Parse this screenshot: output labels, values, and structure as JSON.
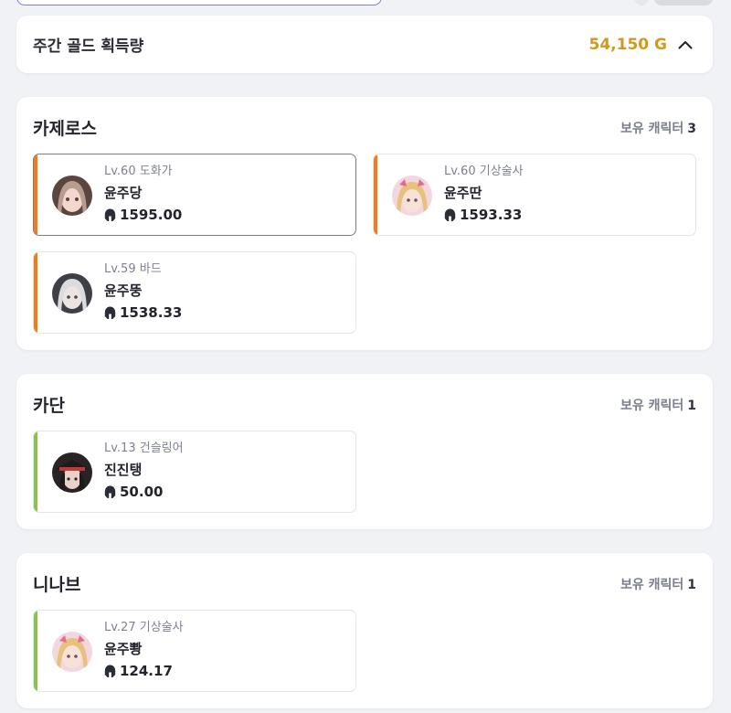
{
  "colors": {
    "gold": "#d4981c",
    "bar_orange": "#f07d1a",
    "bar_green": "#8bc34a",
    "bg": "#f1f2f6"
  },
  "weekly": {
    "title": "주간 골드 획득량",
    "gold": "54,150 G",
    "toggle_icon": "chevron-up-icon"
  },
  "count_label": "보유 캐릭터",
  "servers": [
    {
      "name": "카제로스",
      "count": "3",
      "characters": [
        {
          "level": "Lv.60",
          "class": "도화가",
          "name": "윤주당",
          "item_level": "1595.00",
          "bar": "orange",
          "avatar": "a1",
          "selected": true
        },
        {
          "level": "Lv.60",
          "class": "기상술사",
          "name": "윤주딴",
          "item_level": "1593.33",
          "bar": "orange",
          "avatar": "a2",
          "selected": false
        },
        {
          "level": "Lv.59",
          "class": "바드",
          "name": "윤주뚱",
          "item_level": "1538.33",
          "bar": "orange",
          "avatar": "a3",
          "selected": false
        }
      ]
    },
    {
      "name": "카단",
      "count": "1",
      "characters": [
        {
          "level": "Lv.13",
          "class": "건슬링어",
          "name": "진진탱",
          "item_level": "50.00",
          "bar": "green",
          "avatar": "a4",
          "selected": false
        }
      ]
    },
    {
      "name": "니나브",
      "count": "1",
      "characters": [
        {
          "level": "Lv.27",
          "class": "기상술사",
          "name": "윤주뽱",
          "item_level": "124.17",
          "bar": "green",
          "avatar": "a2",
          "selected": false
        }
      ]
    }
  ]
}
